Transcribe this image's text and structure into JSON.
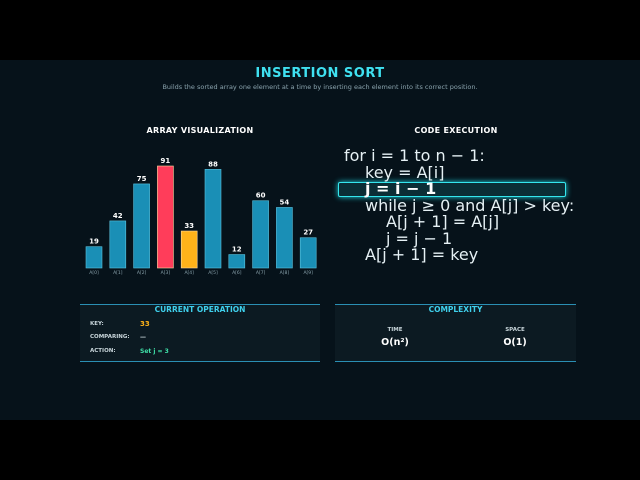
{
  "header": {
    "title": "INSERTION SORT",
    "subtitle": "Builds the sorted array one element at a time by inserting each element into its correct position."
  },
  "sections": {
    "array_title": "ARRAY VISUALIZATION",
    "code_title": "CODE EXECUTION"
  },
  "colors": {
    "default": "#1a8fb6",
    "key": "#ff3d5a",
    "compare": "#ffb31a",
    "accent": "#3fe0f0"
  },
  "chart_data": {
    "type": "bar",
    "categories": [
      "A[0]",
      "A[1]",
      "A[2]",
      "A[3]",
      "A[4]",
      "A[5]",
      "A[6]",
      "A[7]",
      "A[8]",
      "A[9]"
    ],
    "values": [
      19,
      42,
      75,
      91,
      33,
      88,
      12,
      60,
      54,
      27
    ],
    "states": [
      "default",
      "default",
      "default",
      "key",
      "compare",
      "default",
      "default",
      "default",
      "default",
      "default"
    ],
    "ylim": [
      0,
      91
    ]
  },
  "code": {
    "lines": [
      {
        "text": "for i = 1 to n − 1:",
        "indent": 0
      },
      {
        "text": "key = A[i]",
        "indent": 1
      },
      {
        "text": "j = i − 1",
        "indent": 1
      },
      {
        "text": "while j ≥ 0 and A[j] > key:",
        "indent": 1
      },
      {
        "text": "A[j + 1] = A[j]",
        "indent": 2
      },
      {
        "text": "j = j − 1",
        "indent": 2
      },
      {
        "text": "A[j + 1] = key",
        "indent": 1
      }
    ],
    "active_line": 2
  },
  "current_operation": {
    "title": "CURRENT OPERATION",
    "key_label": "KEY:",
    "key_value": "33",
    "comparing_label": "COMPARING:",
    "comparing_value": "—",
    "action_label": "ACTION:",
    "action_value": "Set j = 3"
  },
  "complexity": {
    "title": "COMPLEXITY",
    "time_label": "TIME",
    "time_value": "O(n²)",
    "space_label": "SPACE",
    "space_value": "O(1)"
  }
}
